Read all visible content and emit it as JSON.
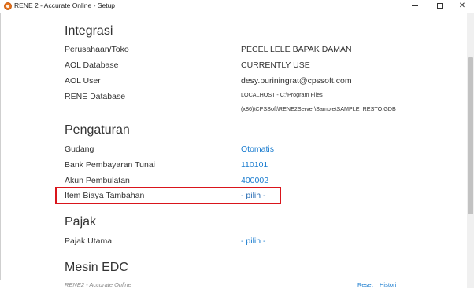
{
  "window": {
    "title": "RENE 2 - Accurate Online - Setup",
    "min_glyph": "",
    "close_glyph": "✕"
  },
  "integrasi": {
    "heading": "Integrasi",
    "rows": [
      {
        "label": "Perusahaan/Toko",
        "value": "PECEL LELE BAPAK DAMAN"
      },
      {
        "label": "AOL Database",
        "value": "CURRENTLY USE"
      },
      {
        "label": "AOL User",
        "value": "desy.puriningrat@cpssoft.com"
      },
      {
        "label": "RENE Database",
        "value_line1": "LOCALHOST - C:\\Program Files",
        "value_line2": "(x86)\\CPSSoft\\RENE2Server\\Sample\\SAMPLE_RESTO.GDB"
      }
    ]
  },
  "pengaturan": {
    "heading": "Pengaturan",
    "rows": [
      {
        "label": "Gudang",
        "value": "Otomatis"
      },
      {
        "label": "Bank Pembayaran Tunai",
        "value": "110101"
      },
      {
        "label": "Akun Pembulatan",
        "value": "400002"
      },
      {
        "label": "Item Biaya Tambahan",
        "value": "- pilih -"
      }
    ]
  },
  "pajak": {
    "heading": "Pajak",
    "rows": [
      {
        "label": "Pajak Utama",
        "value": "- pilih -"
      }
    ]
  },
  "mesin_edc": {
    "heading": "Mesin EDC"
  },
  "footer": {
    "text": "RENE2 - Accurate Online",
    "reset": "Reset",
    "histori": "Histori"
  },
  "colors": {
    "link": "#1a7ccf",
    "highlight": "#d9151b",
    "app_icon": "#e6731e"
  }
}
